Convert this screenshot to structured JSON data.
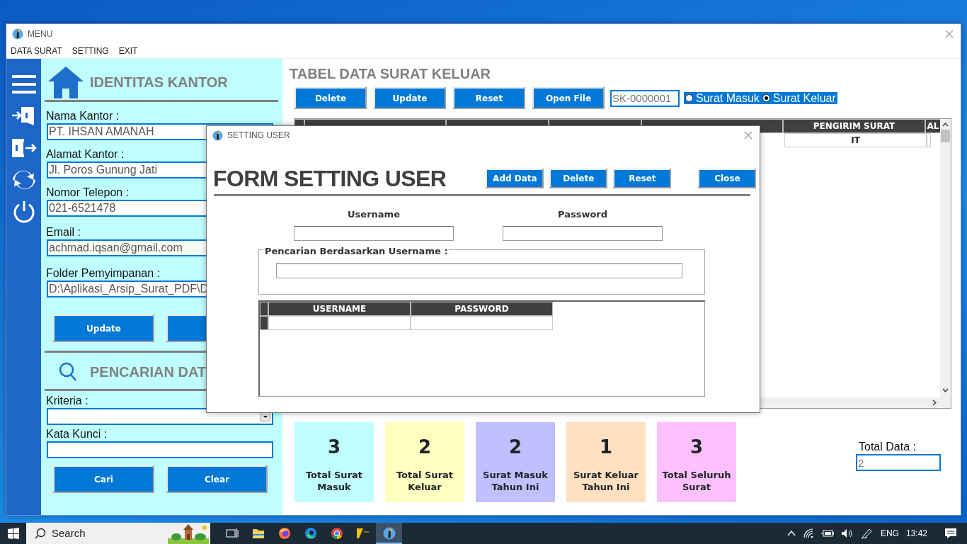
{
  "window": {
    "title": "MENU"
  },
  "menu": [
    "DATA SURAT",
    "SETTING",
    "EXIT"
  ],
  "office_panel": {
    "title": "IDENTITAS KANTOR",
    "fields": [
      {
        "label": "Nama Kantor :",
        "value": "PT. IHSAN AMANAH"
      },
      {
        "label": "Alamat Kantor :",
        "value": "Jl. Poros Gunung Jati"
      },
      {
        "label": "Nomor Telepon :",
        "value": "021-6521478"
      },
      {
        "label": "Email :",
        "value": "achmad.iqsan@gmail.com"
      },
      {
        "label": "Folder Pemyimpanan :",
        "value": "D:\\Aplikasi_Arsip_Surat_PDF\\D"
      }
    ],
    "buttons": [
      "Update"
    ]
  },
  "search_panel": {
    "title": "PENCARIAN DAT",
    "criteria_label": "Kriteria :",
    "keyword_label": "Kata Kunci :",
    "buttons": [
      "Cari",
      "Clear"
    ]
  },
  "table_panel": {
    "title": "TABEL DATA SURAT KELUAR",
    "buttons": [
      "Delete",
      "Update",
      "Reset",
      "Open File"
    ],
    "code_field": "SK-0000001",
    "radios": [
      {
        "label": "Surat Masuk",
        "selected": false
      },
      {
        "label": "Surat Keluar",
        "selected": true
      }
    ],
    "table": {
      "columns": [
        "PENGIRIM SURAT",
        "AL"
      ],
      "rows": [
        [
          "IT"
        ]
      ]
    }
  },
  "stats": [
    {
      "value": "3",
      "label": "Total Surat Masuk",
      "color": "#c0ffff"
    },
    {
      "value": "2",
      "label": "Total Surat Keluar",
      "color": "#ffffc0"
    },
    {
      "value": "2",
      "label": "Surat Masuk Tahun Ini",
      "color": "#c0c0ff"
    },
    {
      "value": "1",
      "label": "Surat Keluar Tahun Ini",
      "color": "#ffe0c0"
    },
    {
      "value": "3",
      "label": "Total Seluruh Surat",
      "color": "#ffc0ff"
    }
  ],
  "total_data": {
    "label": "Total Data :",
    "value": "2"
  },
  "dialog": {
    "title": "SETTING USER",
    "heading": "FORM SETTING USER",
    "buttons": [
      "Add Data",
      "Delete",
      "Reset",
      "Close"
    ],
    "fields": [
      {
        "label": "Username"
      },
      {
        "label": "Password"
      }
    ],
    "search_group": {
      "legend": "Pencarian Berdasarkan Username :"
    },
    "grid": {
      "columns": [
        "USERNAME",
        "PASSWORD"
      ]
    }
  },
  "taskbar": {
    "search_placeholder": "Search",
    "language": "ENG",
    "time": "13:42",
    "apps": [
      {
        "kind": "taskview",
        "selected": false
      },
      {
        "kind": "folder",
        "selected": false
      },
      {
        "kind": "firefox",
        "selected": false
      },
      {
        "kind": "edge",
        "selected": false
      },
      {
        "kind": "chrome",
        "selected": false
      },
      {
        "kind": "zip",
        "selected": false
      },
      {
        "kind": "app",
        "selected": true
      }
    ]
  }
}
